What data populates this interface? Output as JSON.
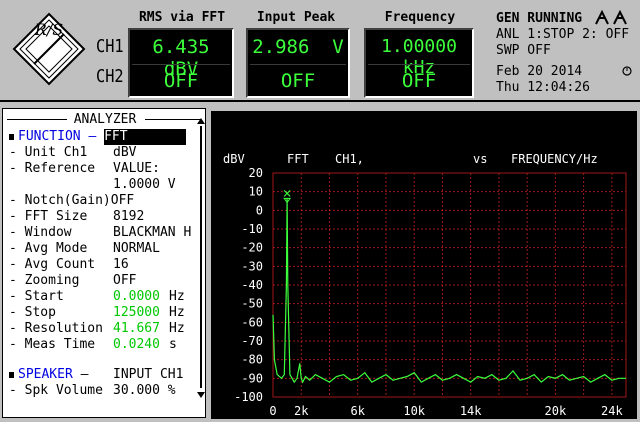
{
  "header": {
    "logo_text": "R/S",
    "channels": [
      "CH1",
      "CH2"
    ],
    "meters": [
      {
        "title": "RMS via FFT",
        "ch1": "6.435 dBV",
        "ch2": "OFF"
      },
      {
        "title": "Input Peak",
        "ch1": "2.986  V",
        "ch2": "OFF"
      },
      {
        "title": "Frequency",
        "ch1": "1.00000 kHz",
        "ch2": "OFF"
      }
    ],
    "status": {
      "line1": "GEN RUNNING",
      "line2": "ANL 1:STOP 2: OFF",
      "line3": "SWP OFF",
      "date": "Feb 20 2014",
      "time": "Thu 12:04:26"
    }
  },
  "analyzer": {
    "title": "ANALYZER",
    "rows": [
      {
        "label": "FUNCTION",
        "value": "FFT"
      },
      {
        "label": "Unit Ch1",
        "value": "dBV"
      },
      {
        "label": "Reference",
        "value": "VALUE:"
      },
      {
        "label": "",
        "value": "1.0000 V"
      },
      {
        "label": "Notch(Gain)",
        "value": "OFF"
      },
      {
        "label": "FFT Size",
        "value": "8192"
      },
      {
        "label": "Window",
        "value": "BLACKMAN H"
      },
      {
        "label": "Avg Mode",
        "value": "NORMAL"
      },
      {
        "label": "Avg Count",
        "value": "16"
      },
      {
        "label": "Zooming",
        "value": "OFF"
      },
      {
        "label": "Start",
        "value": "0.0000",
        "unit": "Hz"
      },
      {
        "label": "Stop",
        "value": "125000",
        "unit": "Hz"
      },
      {
        "label": "Resolution",
        "value": "41.667",
        "unit": "Hz"
      },
      {
        "label": "Meas Time",
        "value": "0.0240",
        "unit": "s"
      },
      {
        "label": "SPEAKER",
        "value": "INPUT CH1"
      },
      {
        "label": "Spk Volume",
        "value": "30.000 %"
      }
    ]
  },
  "chart_data": {
    "type": "line",
    "title_left": "FFT",
    "title_ch": "CH1,",
    "title_vs": "vs",
    "title_right": "FREQUENCY/Hz",
    "ylabel": "dBV",
    "ylim": [
      -100,
      20
    ],
    "yticks": [
      20,
      10,
      0,
      -10,
      -20,
      -30,
      -40,
      -50,
      -60,
      -70,
      -80,
      -90,
      -100
    ],
    "xlim": [
      0,
      25000
    ],
    "xticks": [
      0,
      2000,
      6000,
      10000,
      14000,
      20000,
      24000
    ],
    "xticklabels": [
      "0",
      "2k",
      "6k",
      "10k",
      "14k",
      "20k",
      "24k"
    ],
    "grid": true,
    "marker": {
      "x": 1000,
      "y": 6.4
    },
    "colors": {
      "trace": "#3cff3c",
      "grid": "#a01818",
      "marker": "#3cff3c"
    },
    "series": [
      {
        "x": [
          0,
          100,
          300,
          600,
          800,
          950,
          1000,
          1050,
          1200,
          1500,
          1700,
          1900,
          2000,
          2100,
          2300,
          2600,
          3000,
          3500,
          4000,
          4500,
          5000,
          5500,
          6000,
          6500,
          7000,
          7500,
          8000,
          8500,
          9000,
          9500,
          10000,
          10500,
          11000,
          11500,
          12000,
          12500,
          13000,
          13500,
          14000,
          14500,
          15000,
          15500,
          16000,
          16500,
          17000,
          17500,
          18000,
          18500,
          19000,
          19500,
          20000,
          20500,
          21000,
          21500,
          22000,
          22500,
          23000,
          23500,
          24000,
          24500,
          25000
        ],
        "y": [
          -56,
          -80,
          -88,
          -90,
          -88,
          -40,
          6.4,
          -40,
          -88,
          -92,
          -90,
          -82,
          -90,
          -92,
          -89,
          -91,
          -88,
          -90,
          -92,
          -89,
          -88,
          -91,
          -90,
          -87,
          -92,
          -90,
          -88,
          -91,
          -90,
          -89,
          -87,
          -92,
          -90,
          -88,
          -91,
          -90,
          -88,
          -90,
          -92,
          -89,
          -90,
          -88,
          -91,
          -90,
          -86,
          -91,
          -90,
          -88,
          -92,
          -89,
          -90,
          -88,
          -91,
          -90,
          -89,
          -92,
          -90,
          -88,
          -91,
          -90,
          -90
        ]
      }
    ]
  }
}
